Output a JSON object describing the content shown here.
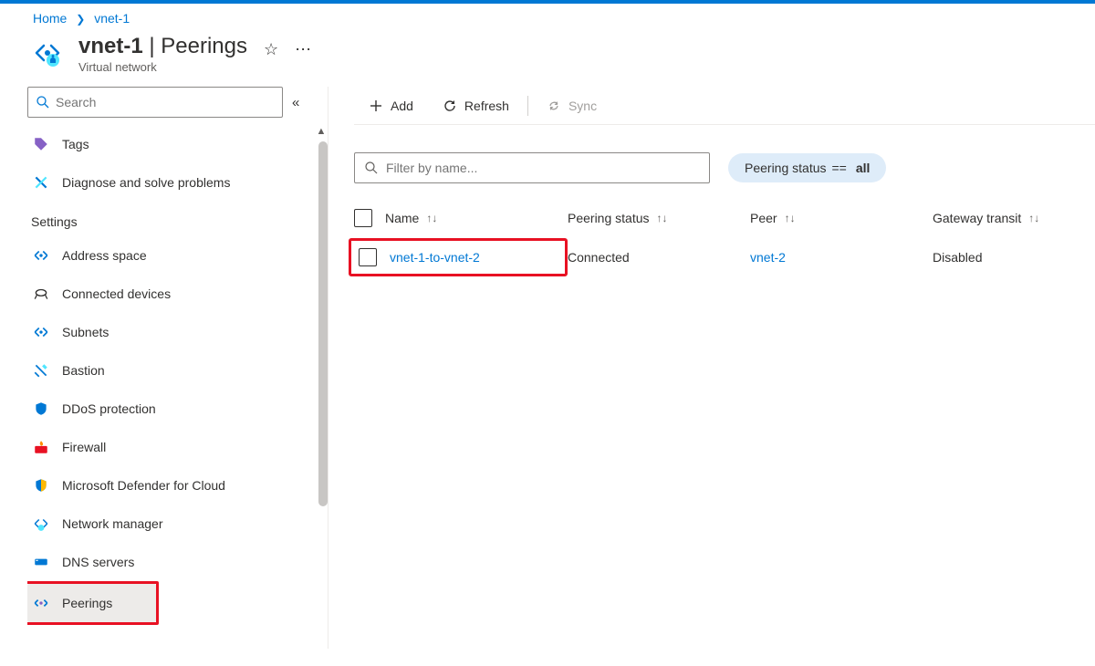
{
  "breadcrumb": {
    "home": "Home",
    "resource": "vnet-1"
  },
  "header": {
    "name": "vnet-1",
    "section": "Peerings",
    "subtitle": "Virtual network"
  },
  "sidebar": {
    "search_placeholder": "Search",
    "groups": {
      "settings": "Settings"
    },
    "items": {
      "tags": "Tags",
      "diagnose": "Diagnose and solve problems",
      "address_space": "Address space",
      "connected_devices": "Connected devices",
      "subnets": "Subnets",
      "bastion": "Bastion",
      "ddos": "DDoS protection",
      "firewall": "Firewall",
      "defender": "Microsoft Defender for Cloud",
      "network_manager": "Network manager",
      "dns_servers": "DNS servers",
      "peerings": "Peerings"
    }
  },
  "toolbar": {
    "add": "Add",
    "refresh": "Refresh",
    "sync": "Sync"
  },
  "filters": {
    "filter_placeholder": "Filter by name...",
    "pill_field": "Peering status",
    "pill_op": "==",
    "pill_value": "all"
  },
  "table": {
    "columns": {
      "name": "Name",
      "status": "Peering status",
      "peer": "Peer",
      "gateway": "Gateway transit"
    },
    "rows": [
      {
        "name": "vnet-1-to-vnet-2",
        "status": "Connected",
        "peer": "vnet-2",
        "gateway": "Disabled"
      }
    ]
  }
}
